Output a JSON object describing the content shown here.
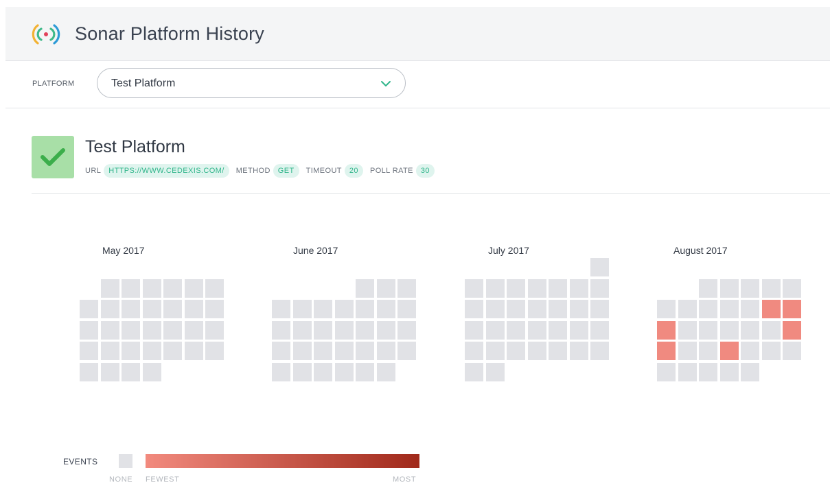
{
  "header": {
    "title": "Sonar Platform History",
    "logo_icon": "radio-signal-icon"
  },
  "selector": {
    "label": "PLATFORM",
    "selected": "Test Platform"
  },
  "platform": {
    "name": "Test Platform",
    "status": "ok",
    "meta": {
      "url_label": "URL",
      "url_value": "HTTPS://WWW.CEDEXIS.COM/",
      "method_label": "METHOD",
      "method_value": "GET",
      "timeout_label": "TIMEOUT",
      "timeout_value": "20",
      "pollrate_label": "POLL RATE",
      "pollrate_value": "30"
    }
  },
  "calendar": {
    "months": [
      {
        "title": "May 2017",
        "first_weekday": 1,
        "days": 31,
        "events": []
      },
      {
        "title": "June 2017",
        "first_weekday": 4,
        "days": 30,
        "events": []
      },
      {
        "title": "July 2017",
        "first_weekday": 6,
        "days": 31,
        "events": []
      },
      {
        "title": "August 2017",
        "first_weekday": 2,
        "days": 31,
        "events": [
          11,
          12,
          13,
          19,
          20,
          23
        ]
      }
    ]
  },
  "legend": {
    "label": "EVENTS",
    "none": "NONE",
    "fewest": "FEWEST",
    "most": "MOST",
    "colors": {
      "none": "#e1e2e6",
      "fewest": "#f28a7e",
      "most": "#a0291a",
      "accent": "#2fb58a"
    }
  }
}
